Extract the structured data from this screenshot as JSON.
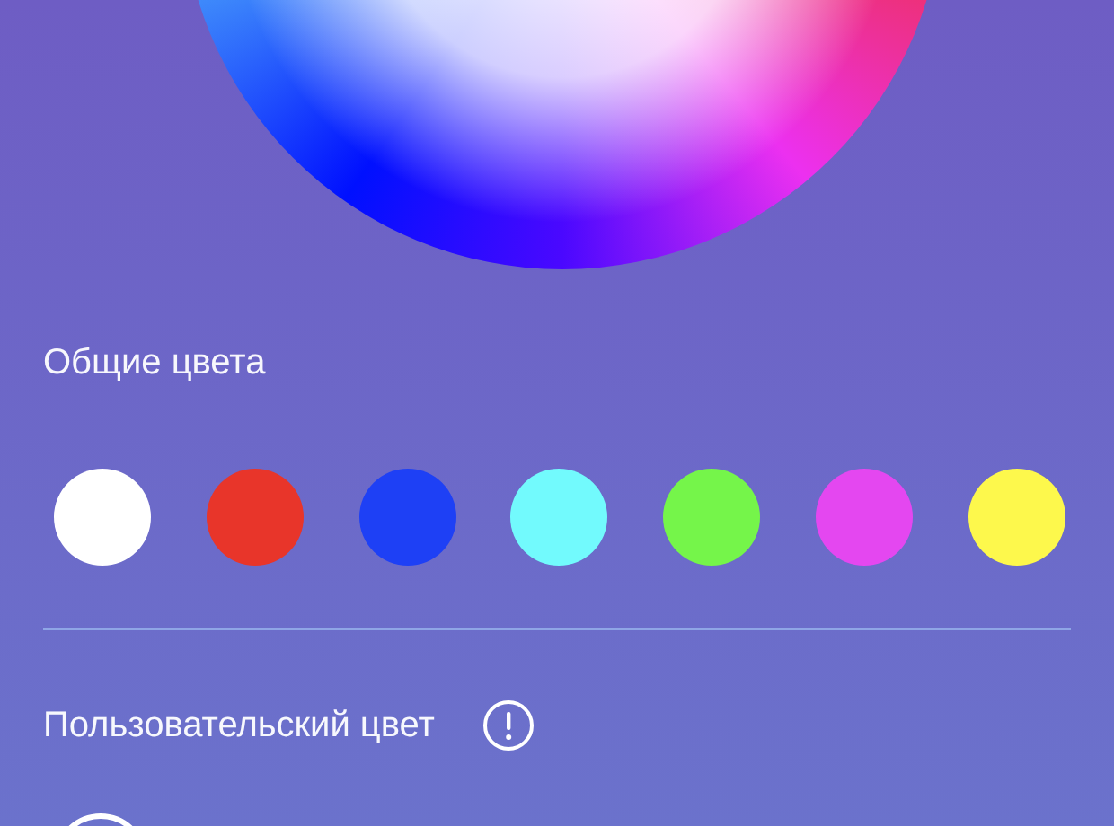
{
  "common_colors": {
    "title": "Общие цвета",
    "swatches": [
      {
        "color": "#ffffff"
      },
      {
        "color": "#e8352a"
      },
      {
        "color": "#1e40f5"
      },
      {
        "color": "#72fafd"
      },
      {
        "color": "#75f54a"
      },
      {
        "color": "#e447f0"
      },
      {
        "color": "#fdf84c"
      }
    ]
  },
  "custom_color": {
    "title": "Пользовательский цвет"
  }
}
